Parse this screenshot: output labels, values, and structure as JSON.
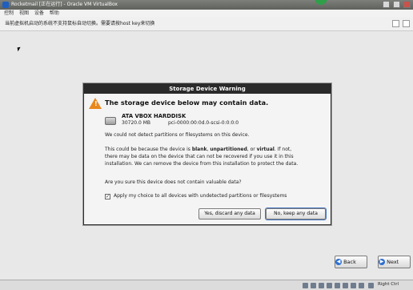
{
  "window": {
    "title": "Rocketmail [正在运行] - Oracle VM VirtualBox",
    "menu": [
      "控制",
      "视图",
      "设备",
      "帮助"
    ],
    "notification": "当前虚拟机启动的系统不支持鼠标自动切换。需要请按host key来切换"
  },
  "dialog": {
    "title": "Storage Device Warning",
    "headline": "The storage device below may contain data.",
    "device_name": "ATA VBOX HARDDISK",
    "device_size": "30720.0 MB",
    "device_path": "pci-0000:00:0d.0-scsi-0:0:0:0",
    "para1": "We could not detect partitions or filesystems on this device.",
    "para2_a": "This could be because the device is ",
    "para2_b1": "blank",
    "para2_sep1": ", ",
    "para2_b2": "unpartitioned",
    "para2_sep2": ", or ",
    "para2_b3": "virtual",
    "para2_c": ". If not, there may be data on the device that can not be recovered if you use it in this installation. We can remove the device from this installation to protect the data.",
    "question": "Are you sure this device does not contain valuable data?",
    "checkbox_label": "Apply my choice to all devices with undetected partitions or filesystems",
    "checkbox_checked": true,
    "discard_label": "Yes, discard any data",
    "keep_label": "No, keep any data"
  },
  "nav": {
    "back_label": "Back",
    "next_label": "Next"
  },
  "statusbar": {
    "host_key": "Right Ctrl"
  }
}
